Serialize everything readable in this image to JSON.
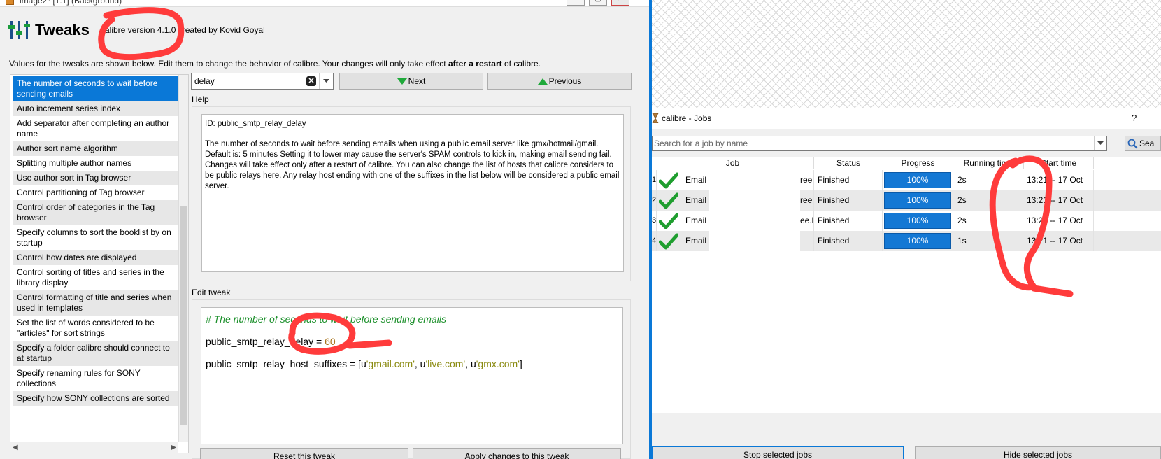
{
  "left_window": {
    "title": "image2* [1:1] (Background)",
    "window_buttons": [
      "—",
      "▢",
      "✕"
    ]
  },
  "tweaks": {
    "title": "Tweaks",
    "subtitle": "calibre version 4.1.0 created by Kovid Goyal",
    "intro_before": "Values for the tweaks are shown below. Edit them to change the behavior of calibre. Your changes will only take effect ",
    "intro_bold": "after a restart",
    "intro_after": " of calibre.",
    "list": [
      "The number of seconds to wait before sending emails",
      "Auto increment series index",
      "Add separator after completing an author name",
      "Author sort name algorithm",
      "Splitting multiple author names",
      "Use author sort in Tag browser",
      "Control partitioning of Tag browser",
      "Control order of categories in the Tag browser",
      "Specify columns to sort the booklist by on startup",
      "Control how dates are displayed",
      "Control sorting of titles and series in the library display",
      "Control formatting of title and series when used in templates",
      "Set the list of words considered to be \"articles\" for sort strings",
      "Specify a folder calibre should connect to at startup",
      "Specify renaming rules for SONY collections",
      "Specify how SONY collections are sorted"
    ],
    "search_value": "delay",
    "next_label": "Next",
    "prev_label": "Previous",
    "help_label": "Help",
    "help_id": "ID: public_smtp_relay_delay",
    "help_text": "The number of seconds to wait before sending emails when using a public email server like gmx/hotmail/gmail. Default is: 5 minutes Setting it to lower may cause the server's SPAM controls to kick in, making email sending fail. Changes will take effect only after a restart of calibre. You can also change the list of hosts that calibre considers to be public relays here. Any relay host ending with one of the suffixes in the list below will be considered a public email server.",
    "edit_label": "Edit tweak",
    "code": {
      "comment": "# The number of seconds to wait before sending emails",
      "delay_name": "public_smtp_relay_delay",
      "eq": " = ",
      "delay_value": "60",
      "suffix_name": "public_smtp_relay_host_suffixes",
      "suffix_open": " = [",
      "u1": "u",
      "s1": "'gmail.com'",
      "sep1": ", ",
      "u2": "u",
      "s2": "'live.com'",
      "sep2": ", ",
      "u3": "u",
      "s3": "'gmx.com'",
      "close": "]"
    },
    "reset_label": "Reset this tweak",
    "apply_label": "Apply changes to this tweak"
  },
  "jobs": {
    "title": "calibre - Jobs",
    "help": "?",
    "search_placeholder": "Search for a job by name",
    "search_button": "Sea",
    "headers": [
      "Job",
      "Status",
      "Progress",
      "Running time",
      "Start time"
    ],
    "rows": [
      {
        "num": "1",
        "job_start": "Email S",
        "job_end": "ree.kindle.com",
        "status": "Finished",
        "progress": 100,
        "progress_label": "100%",
        "running": "2s",
        "start": "13:21 -- 17 Oct"
      },
      {
        "num": "2",
        "job_start": "Email S",
        "job_end": "ree.kindle.com",
        "status": "Finished",
        "progress": 100,
        "progress_label": "100%",
        "running": "2s",
        "start": "13:21 -- 17 Oct"
      },
      {
        "num": "3",
        "job_start": "Email S",
        "job_end": "ee.kindle.com",
        "status": "Finished",
        "progress": 100,
        "progress_label": "100%",
        "running": "2s",
        "start": "13:21 -- 17 Oct"
      },
      {
        "num": "4",
        "job_start": "Email S",
        "job_end": "",
        "status": "Finished",
        "progress": 100,
        "progress_label": "100%",
        "running": "1s",
        "start": "13:21 -- 17 Oct"
      }
    ],
    "stop_label": "Stop selected jobs",
    "hide_label": "Hide selected jobs"
  },
  "colors": {
    "selection": "#0a78d7",
    "annotation": "#ff3b3b",
    "check": "#1f9e2f",
    "progress": "#1478d4"
  }
}
